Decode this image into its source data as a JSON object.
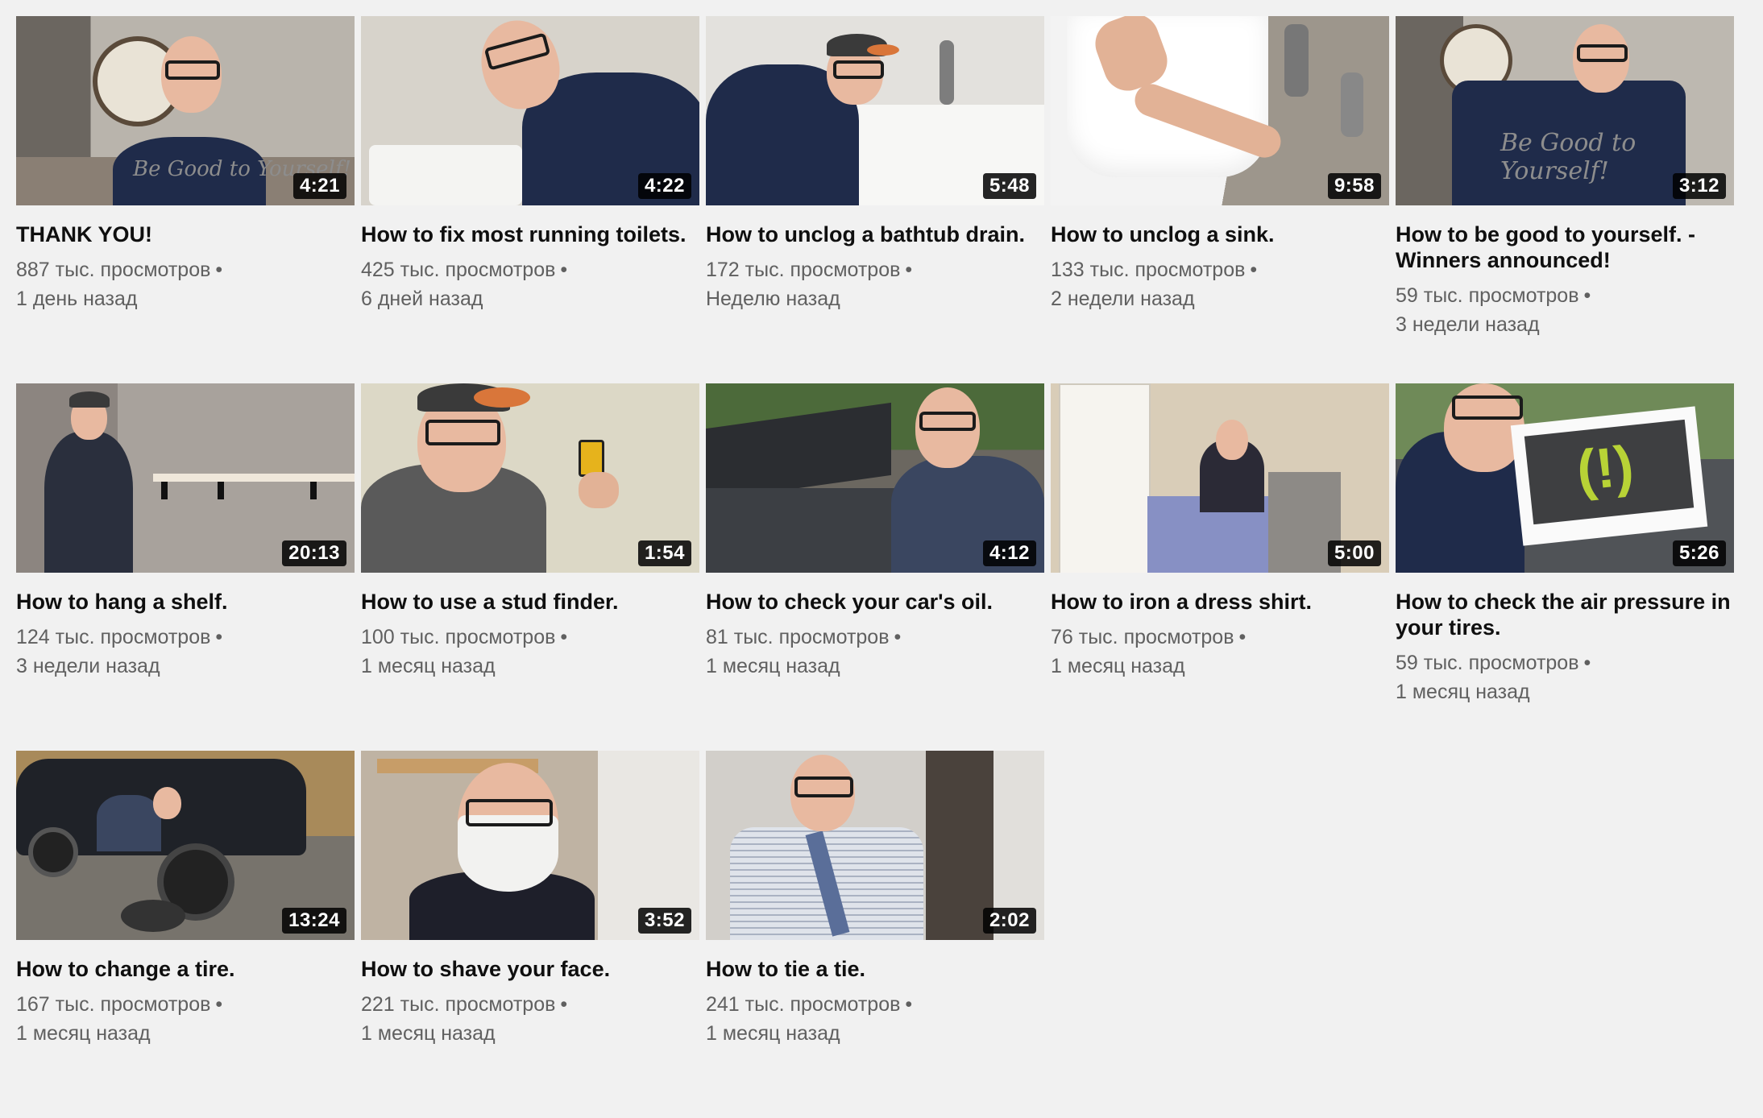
{
  "videos": [
    {
      "title": "THANK YOU!",
      "duration": "4:21",
      "views": "887 тыс. просмотров",
      "age": "1 день назад"
    },
    {
      "title": "How to fix most running toilets.",
      "duration": "4:22",
      "views": "425 тыс. просмотров",
      "age": "6 дней назад"
    },
    {
      "title": "How to unclog a bathtub drain.",
      "duration": "5:48",
      "views": "172 тыс. просмотров",
      "age": "Неделю назад"
    },
    {
      "title": "How to unclog a sink.",
      "duration": "9:58",
      "views": "133 тыс. просмотров",
      "age": "2 недели назад"
    },
    {
      "title": "How to be good to yourself. - Winners announced!",
      "duration": "3:12",
      "views": "59 тыс. просмотров",
      "age": "3 недели назад"
    },
    {
      "title": "How to hang a shelf.",
      "duration": "20:13",
      "views": "124 тыс. просмотров",
      "age": "3 недели назад"
    },
    {
      "title": "How to use a stud finder.",
      "duration": "1:54",
      "views": "100 тыс. просмотров",
      "age": "1 месяц назад"
    },
    {
      "title": "How to check your car's oil.",
      "duration": "4:12",
      "views": "81 тыс. просмотров",
      "age": "1 месяц назад"
    },
    {
      "title": "How to iron a dress shirt.",
      "duration": "5:00",
      "views": "76 тыс. просмотров",
      "age": "1 месяц назад"
    },
    {
      "title": "How to check the air pressure in your tires.",
      "duration": "5:26",
      "views": "59 тыс. просмотров",
      "age": "1 месяц назад"
    },
    {
      "title": "How to change a tire.",
      "duration": "13:24",
      "views": "167 тыс. просмотров",
      "age": "1 месяц назад"
    },
    {
      "title": "How to shave your face.",
      "duration": "3:52",
      "views": "221 тыс. просмотров",
      "age": "1 месяц назад"
    },
    {
      "title": "How to tie a tie.",
      "duration": "2:02",
      "views": "241 тыс. просмотров",
      "age": "1 месяц назад"
    }
  ],
  "separator": "•",
  "thumb_text": {
    "shirt_lettering": "Be Good to Yourself!"
  }
}
